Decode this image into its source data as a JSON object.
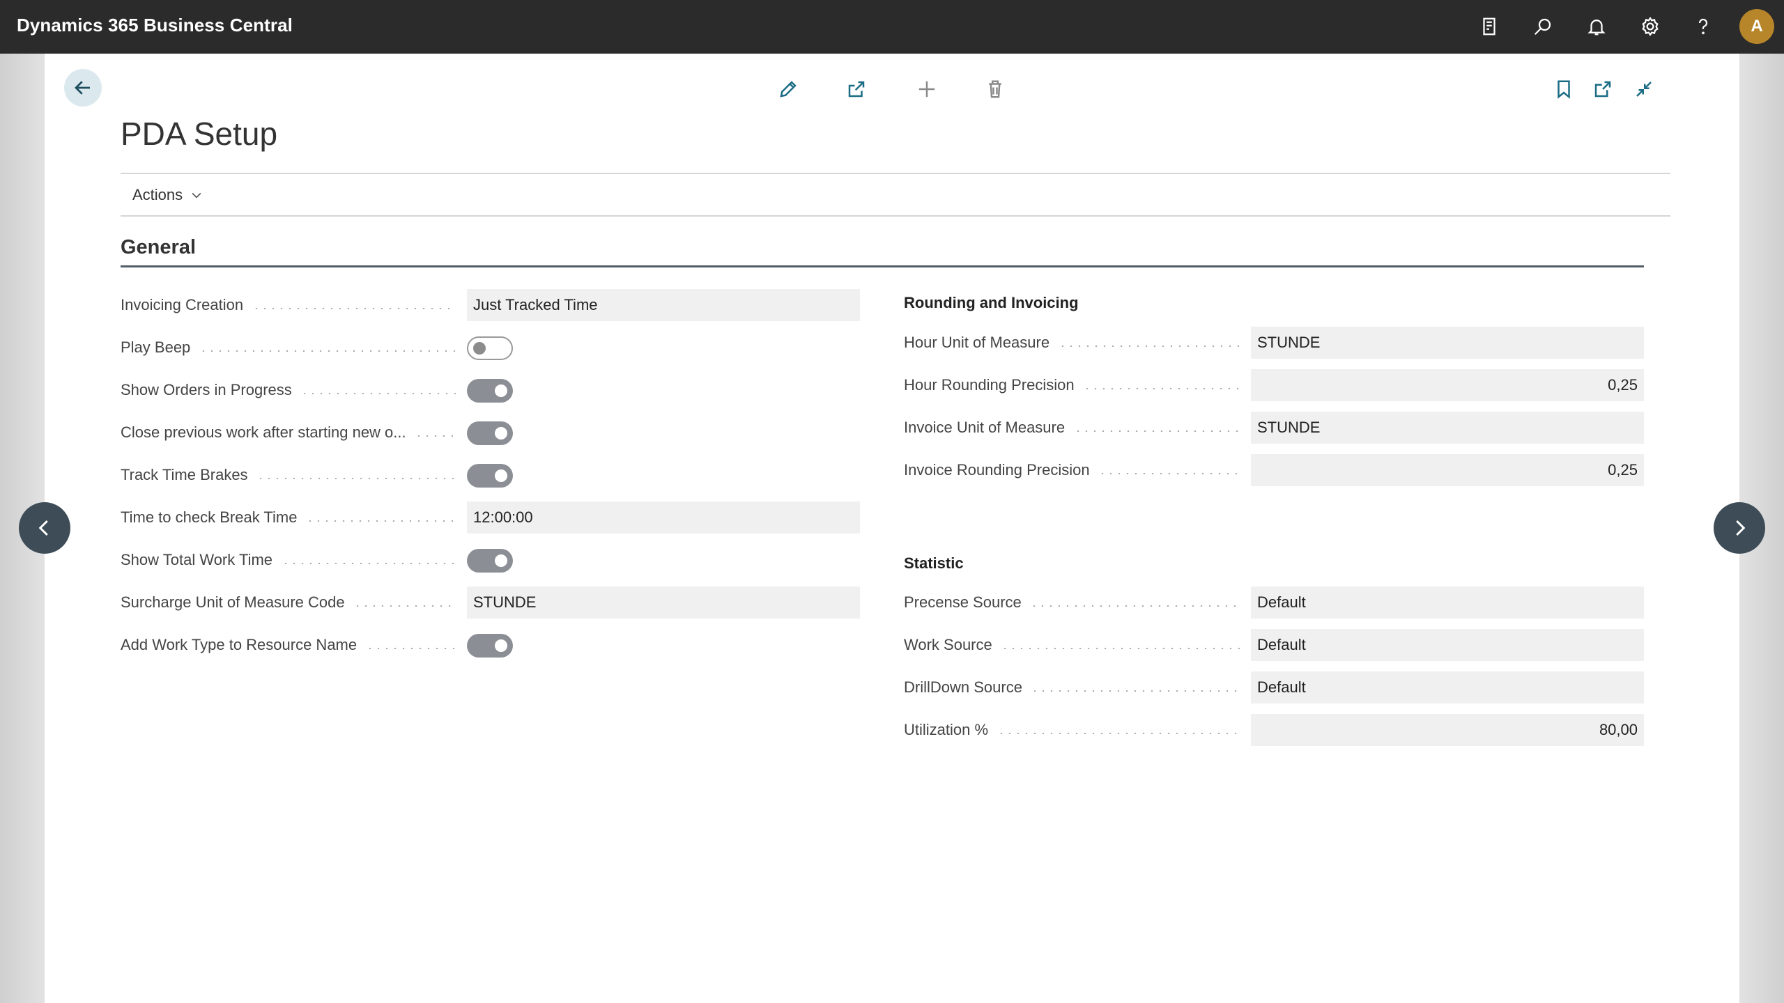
{
  "app": {
    "title": "Dynamics 365 Business Central",
    "avatar_initial": "A"
  },
  "topbar_icons": [
    "report-icon",
    "search-icon",
    "bell-icon",
    "gear-icon",
    "help-icon"
  ],
  "page": {
    "title": "PDA Setup",
    "actions_label": "Actions"
  },
  "general": {
    "title": "General",
    "left_fields": [
      {
        "label": "Invoicing Creation",
        "type": "text",
        "value": "Just Tracked Time"
      },
      {
        "label": "Play Beep",
        "type": "toggle",
        "value": false
      },
      {
        "label": "Show Orders in Progress",
        "type": "toggle",
        "value": true
      },
      {
        "label": "Close previous work after starting new o...",
        "type": "toggle",
        "value": true
      },
      {
        "label": "Track Time Brakes",
        "type": "toggle",
        "value": true
      },
      {
        "label": "Time to check Break Time",
        "type": "text",
        "value": "12:00:00"
      },
      {
        "label": "Show Total Work Time",
        "type": "toggle",
        "value": true
      },
      {
        "label": "Surcharge Unit of Measure Code",
        "type": "text",
        "value": "STUNDE"
      },
      {
        "label": "Add Work Type to Resource Name",
        "type": "toggle",
        "value": true
      }
    ],
    "rounding_title": "Rounding and Invoicing",
    "rounding_fields": [
      {
        "label": "Hour Unit of Measure",
        "type": "text",
        "value": "STUNDE"
      },
      {
        "label": "Hour Rounding Precision",
        "type": "number",
        "value": "0,25"
      },
      {
        "label": "Invoice Unit of Measure",
        "type": "text",
        "value": "STUNDE"
      },
      {
        "label": "Invoice Rounding Precision",
        "type": "number",
        "value": "0,25"
      }
    ],
    "statistic_title": "Statistic",
    "statistic_fields": [
      {
        "label": "Precense Source",
        "type": "text",
        "value": "Default"
      },
      {
        "label": "Work Source",
        "type": "text",
        "value": "Default"
      },
      {
        "label": "DrillDown Source",
        "type": "text",
        "value": "Default"
      },
      {
        "label": "Utilization %",
        "type": "number",
        "value": "80,00"
      }
    ]
  }
}
